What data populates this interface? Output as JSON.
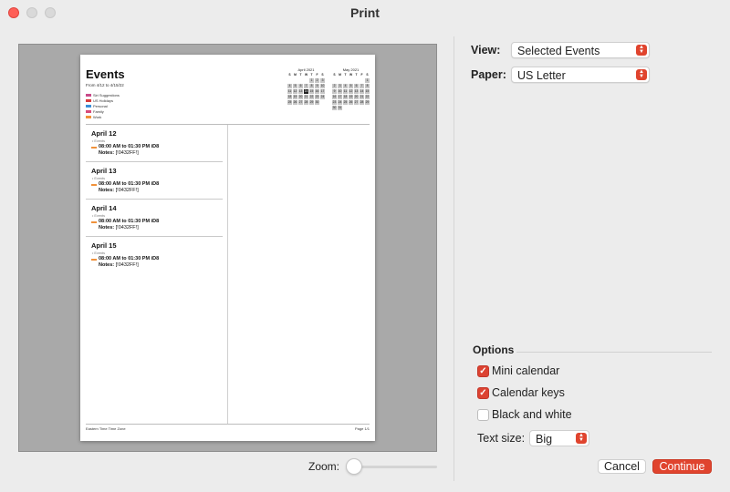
{
  "window": {
    "title": "Print"
  },
  "colors": {
    "accent": "#e0442e",
    "event_swatch": "#f0913a"
  },
  "preview": {
    "title": "Events",
    "date_range": "From 4/12 to 4/15/22",
    "legend": [
      {
        "label": "Siri Suggestions",
        "color": "#c94a8a"
      },
      {
        "label": "US Holidays",
        "color": "#d83b3b"
      },
      {
        "label": "Personal",
        "color": "#3b8fd8"
      },
      {
        "label": "Family",
        "color": "#d84a7a"
      },
      {
        "label": "Work",
        "color": "#f0913a"
      }
    ],
    "mini_calendars": [
      {
        "title": "April 2021",
        "weekdays": [
          "S",
          "M",
          "T",
          "W",
          "T",
          "F",
          "S"
        ],
        "days": [
          "",
          "",
          "",
          "",
          "1",
          "2",
          "3",
          "4",
          "5",
          "6",
          "7",
          "8",
          "9",
          "10",
          "11",
          "12",
          "13",
          "14",
          "15",
          "16",
          "17",
          "18",
          "19",
          "20",
          "21",
          "22",
          "23",
          "24",
          "25",
          "26",
          "27",
          "28",
          "29",
          "30",
          ""
        ],
        "today": "14"
      },
      {
        "title": "May 2021",
        "weekdays": [
          "S",
          "M",
          "T",
          "W",
          "T",
          "F",
          "S"
        ],
        "days": [
          "",
          "",
          "",
          "",
          "",
          "",
          "1",
          "2",
          "3",
          "4",
          "5",
          "6",
          "7",
          "8",
          "9",
          "10",
          "11",
          "12",
          "13",
          "14",
          "15",
          "16",
          "17",
          "18",
          "19",
          "20",
          "21",
          "22",
          "23",
          "24",
          "25",
          "26",
          "27",
          "28",
          "29",
          "30",
          "31",
          "",
          "",
          "",
          "",
          ""
        ],
        "today": ""
      }
    ],
    "days": [
      {
        "title": "April 12",
        "calendar": "Events",
        "time": "08:00 AM to 01:30 PM iD8",
        "notes_label": "Notes:",
        "notes_value": "[!0432FF!]"
      },
      {
        "title": "April 13",
        "calendar": "Events",
        "time": "08:00 AM to 01:30 PM iD8",
        "notes_label": "Notes:",
        "notes_value": "[!0432FF!]"
      },
      {
        "title": "April 14",
        "calendar": "Events",
        "time": "08:00 AM to 01:30 PM iD8",
        "notes_label": "Notes:",
        "notes_value": "[!0432FF!]"
      },
      {
        "title": "April 15",
        "calendar": "Events",
        "time": "08:00 AM to 01:30 PM iD8",
        "notes_label": "Notes:",
        "notes_value": "[!0432FF!]"
      }
    ],
    "footer_left": "Eastern Time Time Zone",
    "footer_right": "Page 1/1"
  },
  "zoom": {
    "label": "Zoom:",
    "level": 0
  },
  "settings": {
    "view_label": "View:",
    "view_value": "Selected Events",
    "paper_label": "Paper:",
    "paper_value": "US Letter",
    "options_title": "Options",
    "options": [
      {
        "label": "Mini calendar",
        "checked": true
      },
      {
        "label": "Calendar keys",
        "checked": true
      },
      {
        "label": "Black and white",
        "checked": false
      }
    ],
    "text_size_label": "Text size:",
    "text_size_value": "Big"
  },
  "buttons": {
    "cancel": "Cancel",
    "continue": "Continue"
  }
}
